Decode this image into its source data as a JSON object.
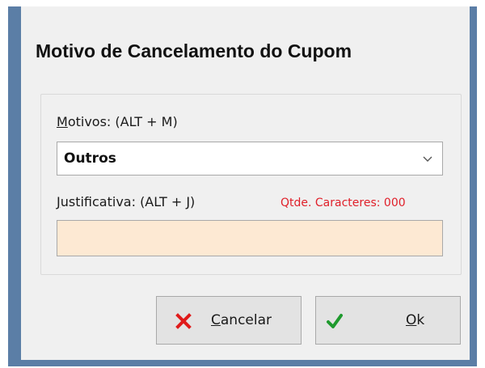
{
  "dialog": {
    "title": "Motivo de Cancelamento do Cupom"
  },
  "motivos": {
    "label_access_key": "M",
    "label_rest": "otivos: (ALT + M)",
    "selected_value": "Outros",
    "dropdown_icon": "chevron-down-icon"
  },
  "justificativa": {
    "label_access_key": "J",
    "label_rest": "ustificativa: (ALT + J)",
    "counter": "Qtde. Caracteres: 000",
    "value": ""
  },
  "buttons": {
    "cancel": {
      "access_key": "C",
      "label_rest": "ancelar",
      "icon": "x-icon",
      "icon_color": "#e01b1b"
    },
    "ok": {
      "access_key": "O",
      "label_rest": "k",
      "icon": "check-icon",
      "icon_color": "#1f9a2e"
    }
  },
  "colors": {
    "counter_text": "#e0202a",
    "textbox_bg": "#fde9d3",
    "window_border": "#5b7ea6"
  }
}
